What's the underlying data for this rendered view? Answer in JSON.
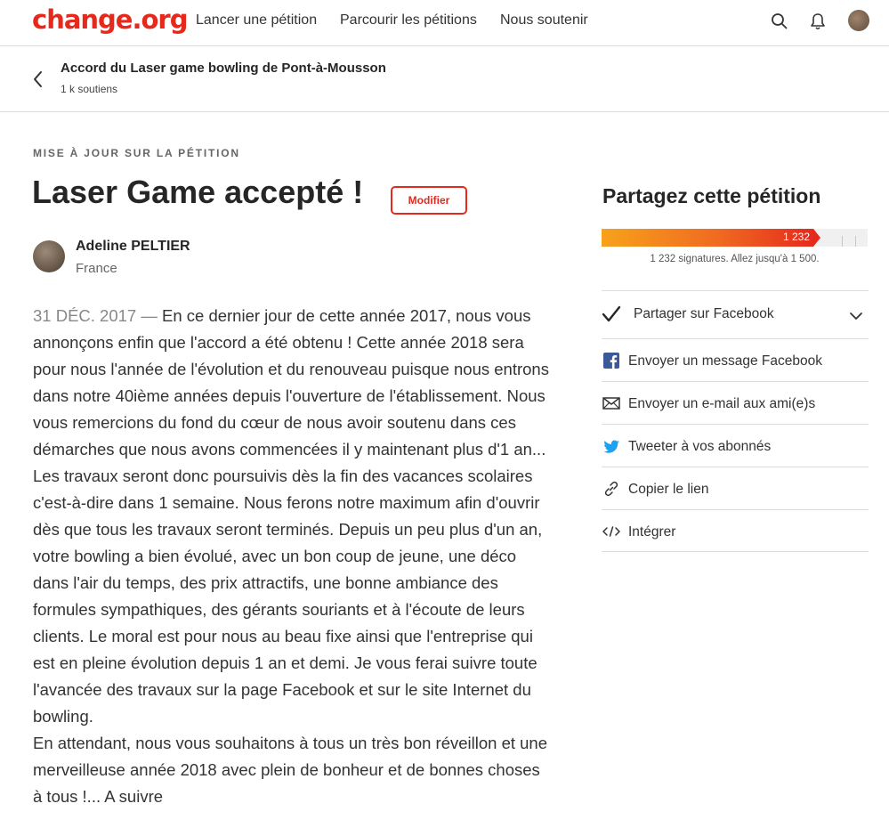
{
  "nav": {
    "logo": "change.org",
    "links": [
      "Lancer une pétition",
      "Parcourir les pétitions",
      "Nous soutenir"
    ]
  },
  "subheader": {
    "title": "Accord du Laser game bowling de Pont-à-Mousson",
    "supporters": "1 k soutiens"
  },
  "article": {
    "kicker": "MISE À JOUR SUR LA PÉTITION",
    "title": "Laser Game accepté !",
    "edit_label": "Modifier",
    "author_name": "Adeline PELTIER",
    "author_country": "France",
    "date": "31 DÉC. 2017 —",
    "body": " En ce dernier jour de cette année 2017, nous vous annonçons enfin que l'accord a été obtenu ! Cette année 2018 sera pour nous l'année de l'évolution et du renouveau puisque nous entrons dans notre 40ième années depuis l'ouverture de l'établissement. Nous vous remercions du fond du cœur de nous avoir soutenu dans ces démarches que nous avons commencées il y maintenant plus d'1 an... Les travaux seront donc poursuivis dès la fin des vacances scolaires c'est-à-dire dans 1 semaine. Nous ferons notre maximum afin d'ouvrir dès que tous les travaux seront terminés. Depuis un peu plus d'un an, votre bowling a bien évolué, avec un bon coup de jeune, une déco dans l'air du temps, des prix attractifs, une bonne ambiance des formules sympathiques, des gérants souriants et à l'écoute de leurs clients. Le moral est pour nous au beau fixe ainsi que l'entreprise qui est en pleine évolution depuis 1 an et demi. Je vous ferai suivre toute l'avancée des travaux sur la page Facebook et sur le site Internet du bowling.",
    "body2": "En attendant, nous vous souhaitons à tous un très bon réveillon et une merveilleuse année 2018 avec plein de bonheur et de bonnes choses à tous !... A suivre"
  },
  "sidebar": {
    "share_title": "Partagez cette pétition",
    "progress": {
      "count_label": "1 232",
      "signatures": 1232,
      "goal": 1500,
      "caption": "1 232 signatures. Allez jusqu'à 1 500."
    },
    "share_items": [
      {
        "label": "Partager sur Facebook",
        "icon": "check-icon"
      },
      {
        "label": "Envoyer un message Facebook",
        "icon": "facebook-icon"
      },
      {
        "label": "Envoyer un e-mail aux ami(e)s",
        "icon": "mail-icon"
      },
      {
        "label": "Tweeter à vos abonnés",
        "icon": "twitter-icon"
      },
      {
        "label": "Copier le lien",
        "icon": "link-icon"
      },
      {
        "label": "Intégrer",
        "icon": "embed-icon"
      }
    ]
  },
  "colors": {
    "brand": "#e52a1d",
    "progress_start": "#f7a21b",
    "facebook": "#3b5998",
    "twitter": "#1da1f2"
  }
}
